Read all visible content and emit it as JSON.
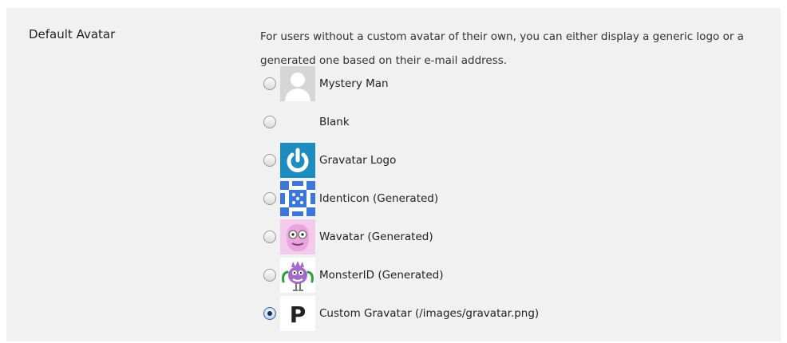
{
  "setting": {
    "label": "Default Avatar",
    "description": "For users without a custom avatar of their own, you can either display a generic logo or a generated one based on their e-mail address."
  },
  "options": [
    {
      "label": "Mystery Man",
      "icon": "mystery-man-icon",
      "checked": false
    },
    {
      "label": "Blank",
      "icon": "blank-icon",
      "checked": false
    },
    {
      "label": "Gravatar Logo",
      "icon": "gravatar-logo-icon",
      "checked": false
    },
    {
      "label": "Identicon (Generated)",
      "icon": "identicon-icon",
      "checked": false
    },
    {
      "label": "Wavatar (Generated)",
      "icon": "wavatar-icon",
      "checked": false
    },
    {
      "label": "MonsterID (Generated)",
      "icon": "monsterid-icon",
      "checked": false
    },
    {
      "label": "Custom Gravatar (/images/gravatar.png)",
      "icon": "custom-p-icon",
      "checked": true
    }
  ],
  "colors": {
    "panel_bg": "#f1f1f1",
    "gravatar_blue": "#1e8cbe",
    "identicon_blue": "#3c78d8",
    "wavatar_pink": "#e9a6dd",
    "monster_purple": "#a26bc7"
  }
}
